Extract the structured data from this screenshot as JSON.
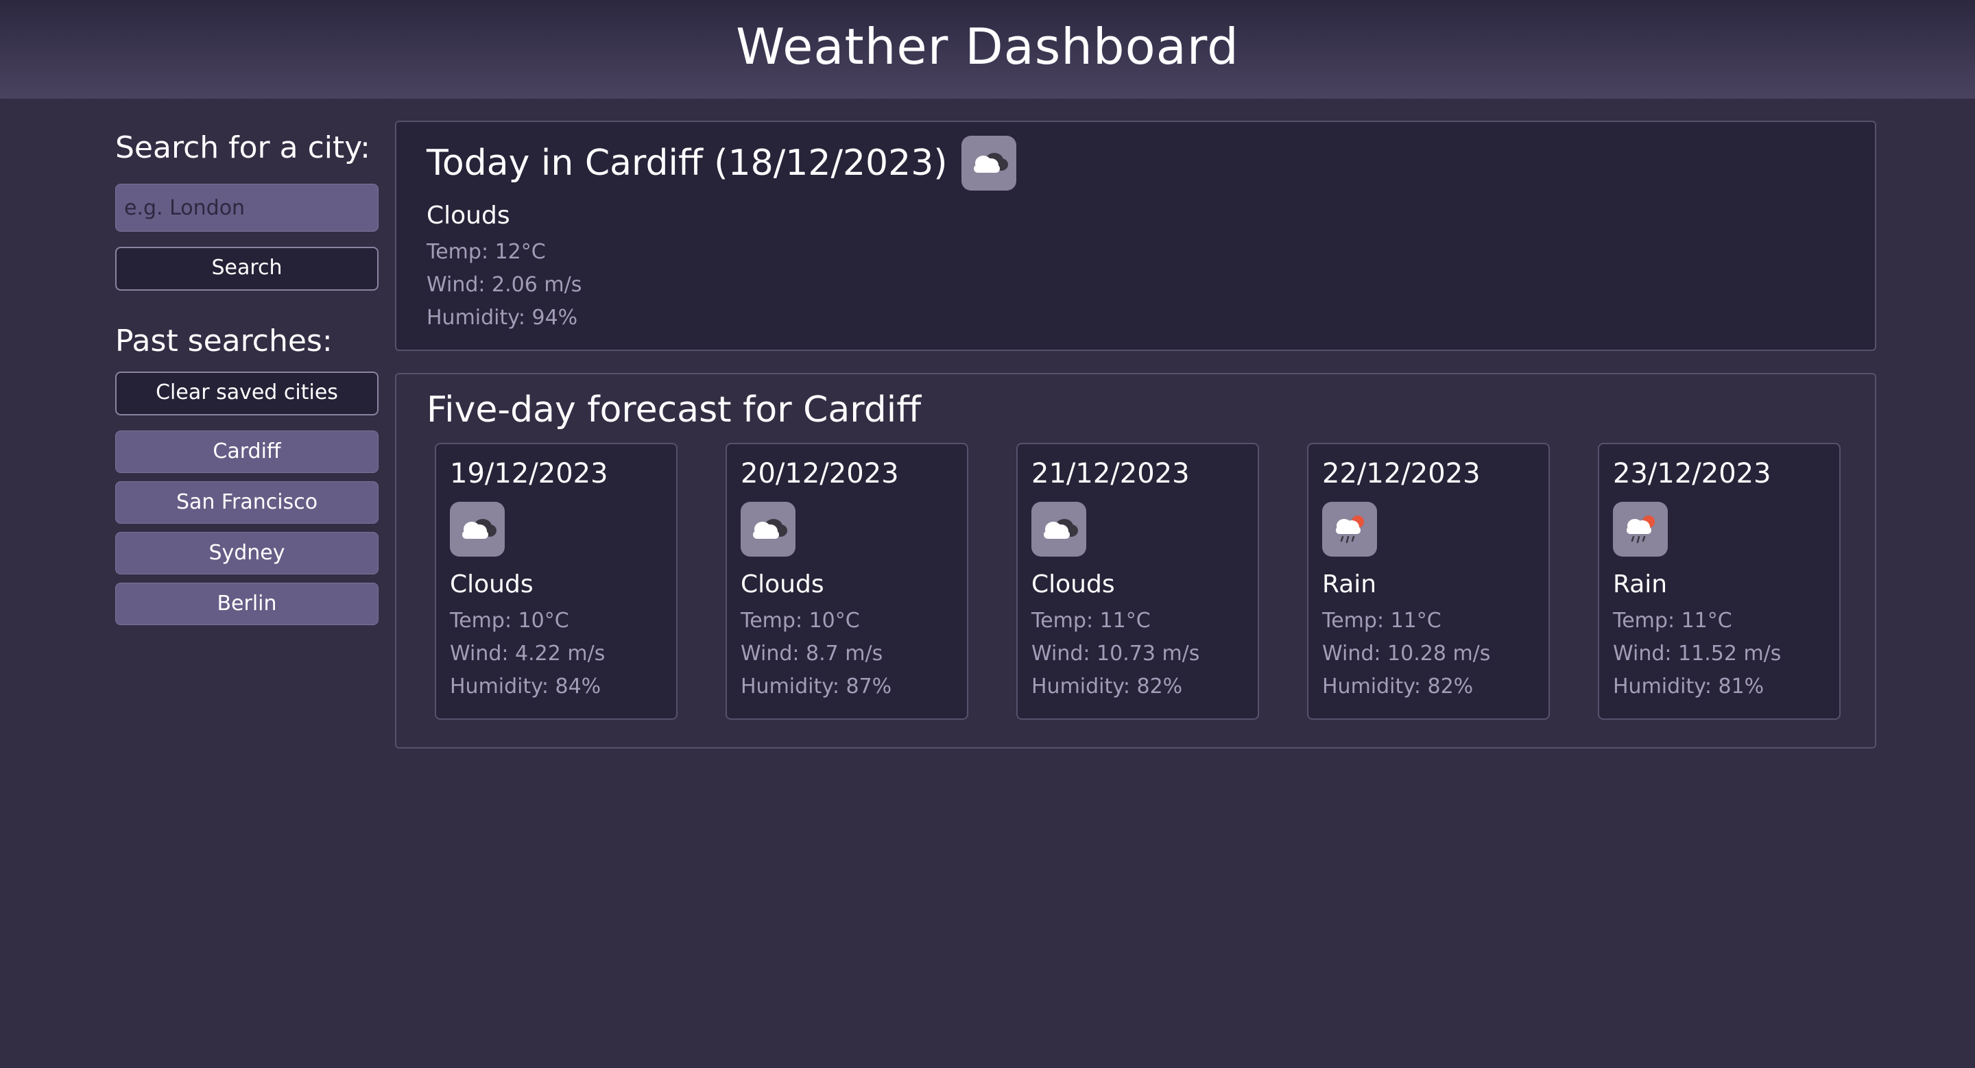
{
  "header": {
    "title": "Weather Dashboard"
  },
  "sidebar": {
    "search_heading": "Search for a city:",
    "search_placeholder": "e.g. London",
    "search_button": "Search",
    "past_heading": "Past searches:",
    "clear_button": "Clear saved cities",
    "cities": [
      "Cardiff",
      "San Francisco",
      "Sydney",
      "Berlin"
    ]
  },
  "today": {
    "title": "Today in Cardiff (18/12/2023)",
    "icon": "clouds-icon",
    "condition": "Clouds",
    "temp": "Temp: 12°C",
    "wind": "Wind: 2.06 m/s",
    "humidity": "Humidity: 94%"
  },
  "forecast": {
    "title": "Five-day forecast for Cardiff",
    "days": [
      {
        "date": "19/12/2023",
        "icon": "clouds-icon",
        "condition": "Clouds",
        "temp": "Temp: 10°C",
        "wind": "Wind: 4.22 m/s",
        "humidity": "Humidity: 84%"
      },
      {
        "date": "20/12/2023",
        "icon": "clouds-icon",
        "condition": "Clouds",
        "temp": "Temp: 10°C",
        "wind": "Wind: 8.7 m/s",
        "humidity": "Humidity: 87%"
      },
      {
        "date": "21/12/2023",
        "icon": "clouds-icon",
        "condition": "Clouds",
        "temp": "Temp: 11°C",
        "wind": "Wind: 10.73 m/s",
        "humidity": "Humidity: 82%"
      },
      {
        "date": "22/12/2023",
        "icon": "rain-icon",
        "condition": "Rain",
        "temp": "Temp: 11°C",
        "wind": "Wind: 10.28 m/s",
        "humidity": "Humidity: 82%"
      },
      {
        "date": "23/12/2023",
        "icon": "rain-icon",
        "condition": "Rain",
        "temp": "Temp: 11°C",
        "wind": "Wind: 11.52 m/s",
        "humidity": "Humidity: 81%"
      }
    ]
  },
  "colors": {
    "background": "#332e44",
    "panel": "#272338",
    "accent_button": "#665d86",
    "icon_bg": "#8a849c",
    "muted_text": "#a39db8"
  }
}
